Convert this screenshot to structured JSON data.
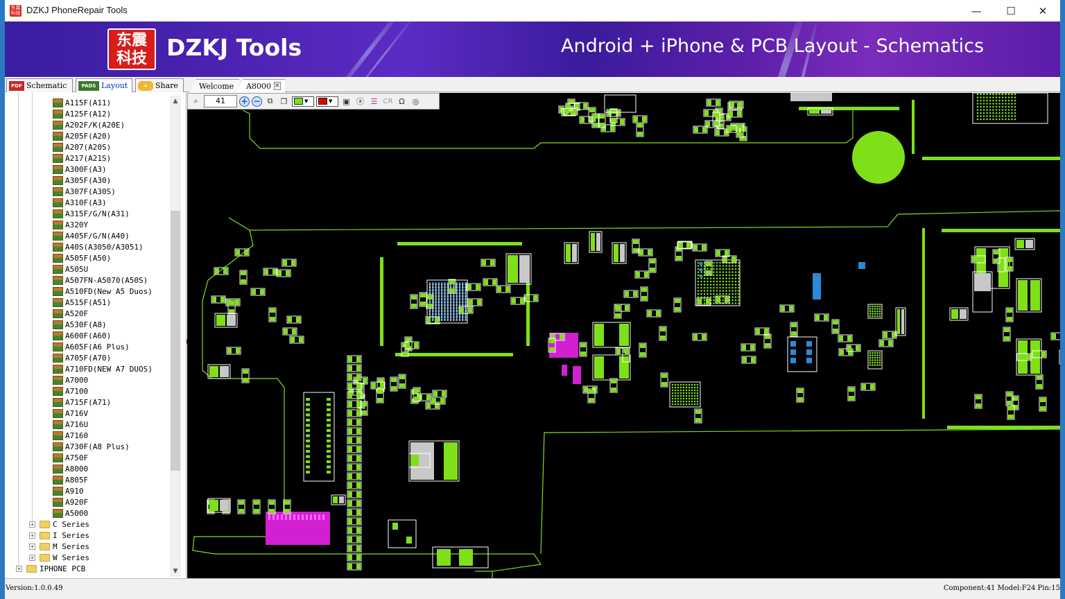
{
  "window": {
    "title": "DZKJ PhoneRepair Tools",
    "minimize": "—",
    "maximize": "☐",
    "close": "✕",
    "app_icon_text": "东震科技"
  },
  "banner": {
    "logo_text": "东震科技",
    "brand": "DZKJ Tools",
    "tagline": "Android + iPhone & PCB Layout - Schematics"
  },
  "function_tabs": [
    {
      "icon": "PDF",
      "label": "Schematic",
      "active": false
    },
    {
      "icon": "PADS",
      "label": "Layout",
      "active": true
    },
    {
      "icon": "+",
      "label": "Share",
      "active": false
    }
  ],
  "doc_tabs": [
    {
      "label": "Welcome",
      "active": false
    },
    {
      "label": "A8000",
      "active": true,
      "closable": true
    }
  ],
  "tree": {
    "models": [
      "A115F(A11)",
      "A125F(A12)",
      "A202F/K(A20E)",
      "A205F(A20)",
      "A207(A20S)",
      "A217(A21S)",
      "A300F(A3)",
      "A305F(A30)",
      "A307F(A30S)",
      "A310F(A3)",
      "A315F/G/N(A31)",
      "A320Y",
      "A405F/G/N(A40)",
      "A40S(A3050/A3051)",
      "A505F(A50)",
      "A505U",
      "A507FN-A5070(A50S)",
      "A510FD(New A5 Duos)",
      "A515F(A51)",
      "A520F",
      "A530F(A8)",
      "A600F(A60)",
      "A605F(A6 Plus)",
      "A705F(A70)",
      "A710FD(NEW A7 DUOS)",
      "A7000",
      "A7100",
      "A715F(A71)",
      "A716V",
      "A716U",
      "A7160",
      "A730F(A8 Plus)",
      "A750F",
      "A8000",
      "A805F",
      "A910",
      "A920F",
      "A5000"
    ],
    "series": [
      "C Series",
      "I Series",
      "M Series",
      "W Series"
    ],
    "root_last": "IPHONE PCB"
  },
  "toolbar": {
    "zoom_value": "41",
    "zoom_in": "+",
    "zoom_out": "−",
    "foreground_color": "#7fe01a",
    "highlight_color": "#e00000"
  },
  "status": {
    "version": "Version:1.0.0.49",
    "info": "Component:41 Model:F24 Pin:15"
  },
  "colors": {
    "pcb_part": "#7fe01a",
    "pcb_grey": "#c8c8c8",
    "pcb_highlight": "#d21fd2",
    "pcb_blue": "#2a8bd8",
    "board_background": "#000000"
  }
}
